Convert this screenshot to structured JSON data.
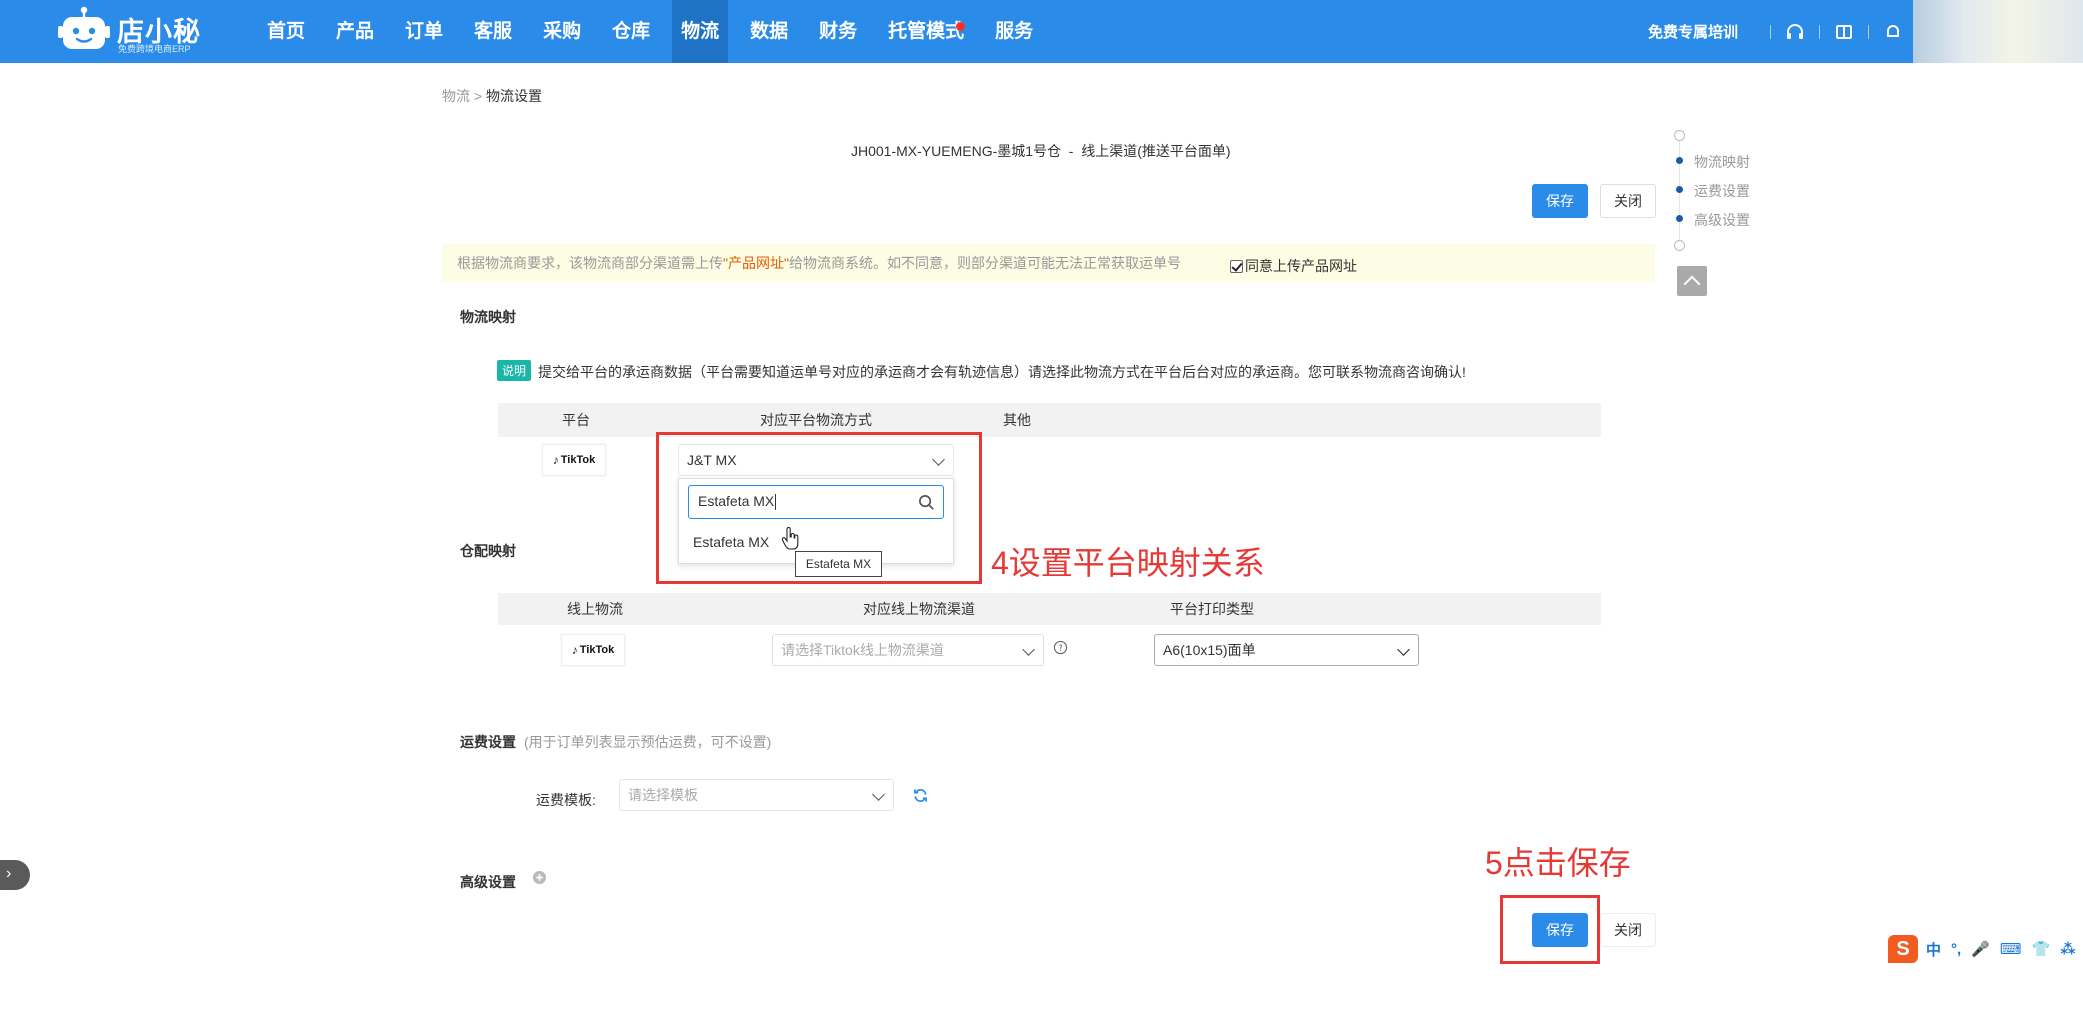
{
  "app": {
    "logo_text": "店小秘",
    "logo_subtitle": "免费跨境电商ERP"
  },
  "nav": {
    "items": [
      "首页",
      "产品",
      "订单",
      "客服",
      "采购",
      "仓库",
      "物流",
      "数据",
      "财务",
      "托管模式",
      "服务"
    ],
    "active": "物流",
    "training": "免费专属培训"
  },
  "breadcrumb": {
    "parent": "物流",
    "separator": ">",
    "current": "物流设置"
  },
  "page_title": "JH001-MX-YUEMENG-墨城1号仓  -  线上渠道(推送平台面单)",
  "buttons": {
    "save": "保存",
    "close": "关闭"
  },
  "notice": {
    "prefix": "根据物流商要求，该物流商部分渠道需上传",
    "link": "\"产品网址\"",
    "suffix": "给物流商系统。如不同意，则部分渠道可能无法正常获取运单号",
    "checkbox_label": "同意上传产品网址",
    "checked": true
  },
  "logistics_mapping": {
    "title": "物流映射",
    "badge": "说明",
    "explain": "提交给平台的承运商数据（平台需要知道运单号对应的承运商才会有轨迹信息）请选择此物流方式在平台后台对应的承运商。您可联系物流商咨询确认!",
    "headers": [
      "平台",
      "对应平台物流方式",
      "其他"
    ],
    "row": {
      "platform": "TikTok",
      "selected": "J&T MX"
    },
    "dropdown": {
      "search_value": "Estafeta MX",
      "option": "Estafeta MX",
      "tooltip": "Estafeta MX"
    }
  },
  "warehouse_mapping": {
    "title": "仓配映射",
    "headers": [
      "线上物流",
      "对应线上物流渠道",
      "平台打印类型"
    ],
    "row": {
      "platform": "TikTok",
      "channel_placeholder": "请选择Tiktok线上物流渠道",
      "print_type": "A6(10x15)面单"
    }
  },
  "freight": {
    "title": "运费设置",
    "hint": "(用于订单列表显示预估运费，可不设置)",
    "template_label": "运费模板:",
    "template_placeholder": "请选择模板"
  },
  "advanced": {
    "title": "高级设置"
  },
  "anchors": [
    "物流映射",
    "运费设置",
    "高级设置"
  ],
  "annotations": {
    "step4": "4设置平台映射关系",
    "step5": "5点击保存"
  },
  "ime": {
    "items": [
      "中",
      "°,",
      "🎤",
      "⌨",
      "👕",
      "⁂"
    ]
  },
  "colors": {
    "nav_bg": "#2a8ce8",
    "primary": "#2a8ce8",
    "annotation_red": "#e53935",
    "notice_bg": "#fdfce4",
    "badge_teal": "#19b7a8"
  }
}
